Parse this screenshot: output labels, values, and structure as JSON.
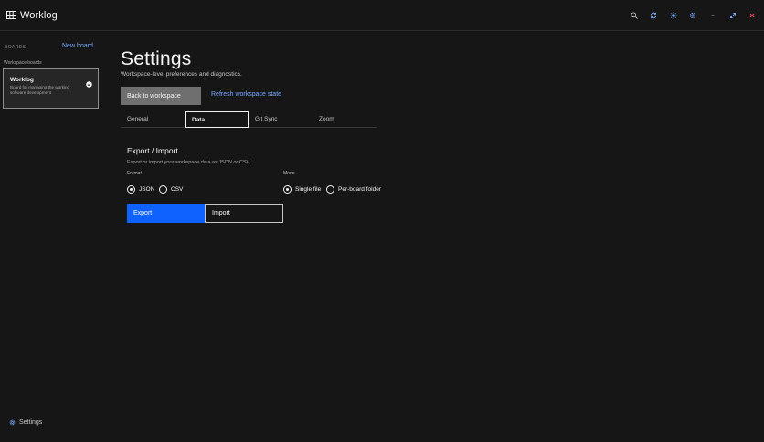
{
  "app": {
    "name": "Worklog"
  },
  "titlebar": {
    "icons": [
      "search-icon",
      "sync-icon",
      "theme-icon",
      "settings-icon",
      "minimize-icon",
      "maximize-icon",
      "close-icon"
    ]
  },
  "sidebar": {
    "boards_label": "BOARDS",
    "new_board": "New board",
    "section_label": "Workspace boards",
    "board": {
      "title": "Worklog",
      "description": "Board for managing the working software development"
    },
    "settings_label": "Settings"
  },
  "main": {
    "title": "Settings",
    "subtitle": "Workspace-level preferences and diagnostics.",
    "back_button": "Back to workspace",
    "refresh_link": "Refresh workspace state",
    "tabs": [
      "General",
      "Data",
      "Git Sync",
      "Zoom"
    ],
    "active_tab": "Data",
    "export_import": {
      "title": "Export / Import",
      "description": "Export or import your workspace data as JSON or CSV.",
      "format_label": "Format",
      "formats": [
        "JSON",
        "CSV"
      ],
      "selected_format": "JSON",
      "mode_label": "Mode",
      "modes": [
        "Single file",
        "Per-board folder"
      ],
      "selected_mode": "Single file",
      "export_button": "Export",
      "import_button": "Import"
    }
  },
  "colors": {
    "background": "#161616",
    "accent": "#0f62fe",
    "link": "#78a9ff",
    "close": "#fa4d56"
  }
}
